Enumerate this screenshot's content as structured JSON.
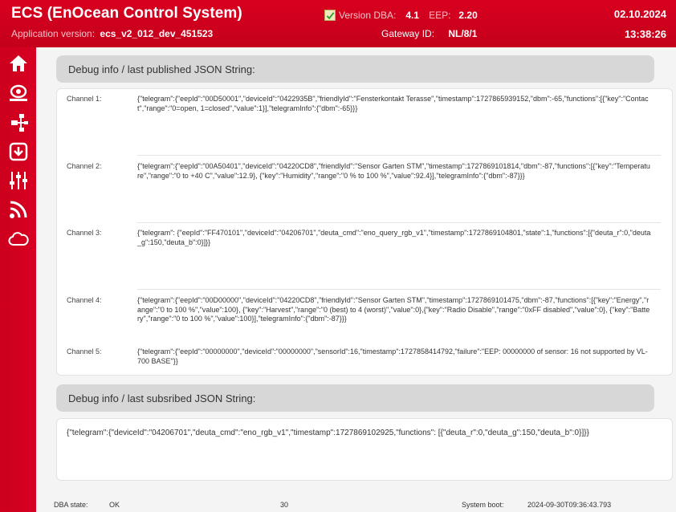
{
  "header": {
    "app_title": "ECS (EnOcean Control System)",
    "app_version_label": "Application version:",
    "app_version_value": "ecs_v2_012_dev_451523",
    "version_dba_label": "Version DBA:",
    "version_dba_value": "4.1",
    "eep_label": "EEP:",
    "eep_value": "2.20",
    "gateway_label": "Gateway ID:",
    "gateway_value": "NL/8/1",
    "date": "02.10.2024",
    "time": "13:38:26"
  },
  "sidebar": {
    "items": [
      {
        "icon": "home-icon"
      },
      {
        "icon": "enocean-icon"
      },
      {
        "icon": "network-icon"
      },
      {
        "icon": "download-icon"
      },
      {
        "icon": "sliders-icon"
      },
      {
        "icon": "rss-icon"
      },
      {
        "icon": "cloud-icon"
      }
    ]
  },
  "published": {
    "title": "Debug info / last published JSON String:",
    "channels": [
      {
        "label": "Channel 1:",
        "json": "{\"telegram\":{\"eepId\":\"00D50001\",\"deviceId\":\"0422935B\",\"friendlyId\":\"Fensterkontakt Terasse\",\"timestamp\":1727865939152,\"dbm\":-65,\"functions\":[{\"key\":\"Contact\",\"range\":\"0=open, 1=closed\",\"value\":1}],\"telegramInfo\":{\"dbm\":-65}}}"
      },
      {
        "label": "Channel 2:",
        "json": "{\"telegram\":{\"eepId\":\"00A50401\",\"deviceId\":\"04220CD8\",\"friendlyId\":\"Sensor Garten STM\",\"timestamp\":1727869101814,\"dbm\":-87,\"functions\":[{\"key\":\"Temperature\",\"range\":\"0 to +40 C\",\"value\":12.9}, {\"key\":\"Humidity\",\"range\":\"0 % to 100 %\",\"value\":92.4}],\"telegramInfo\":{\"dbm\":-87}}}"
      },
      {
        "label": "Channel 3:",
        "json": "{\"telegram\": {\"eepId\":\"FF470101\",\"deviceId\":\"04206701\",\"deuta_cmd\":\"eno_query_rgb_v1\",\"timestamp\":1727869104801,\"state\":1,\"functions\":[{\"deuta_r\":0,\"deuta_g\":150,\"deuta_b\":0}]}}"
      },
      {
        "label": "Channel 4:",
        "json": "{\"telegram\":{\"eepId\":\"00D00000\",\"deviceId\":\"04220CD8\",\"friendlyId\":\"Sensor Garten STM\",\"timestamp\":1727869101475,\"dbm\":-87,\"functions\":[{\"key\":\"Energy\",\"range\":\"0 to 100 %\",\"value\":100}, {\"key\":\"Harvest\",\"range\":\"0 (best) to 4 (worst)\",\"value\":0},{\"key\":\"Radio Disable\",\"range\":\"0xFF disabled\",\"value\":0}, {\"key\":\"Battery\",\"range\":\"0 to 100 %\",\"value\":100}],\"telegramInfo\":{\"dbm\":-87}}}"
      },
      {
        "label": "Channel 5:",
        "json": "{\"telegram\":{\"eepId\":\"00000000\",\"deviceId\":\"00000000\",\"sensorId\":16,\"timestamp\":1727858414792,\"failure\":\"EEP: 00000000 of sensor: 16 not supported by VL-700 BASE\"}}"
      }
    ]
  },
  "subscribed": {
    "title": "Debug info / last subsribed JSON String:",
    "json": "{\"telegram\":{\"deviceId\":\"04206701\",\"deuta_cmd\":\"eno_rgb_v1\",\"timestamp\":1727869102925,\"functions\": [{\"deuta_r\":0,\"deuta_g\":150,\"deuta_b\":0}]}}"
  },
  "footer": {
    "dba_state_label": "DBA state:",
    "dba_state_value": "OK",
    "center_value": "30",
    "system_boot_label": "System boot:",
    "system_boot_value": "2024-09-30T09:36:43.793"
  },
  "colors": {
    "brand_red": "#d4001f",
    "section_header_bg": "#d7d7d7",
    "main_bg": "#f4f4f4"
  }
}
